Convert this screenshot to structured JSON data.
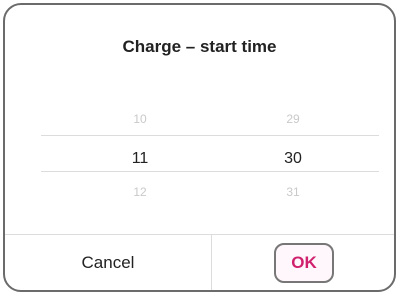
{
  "dialog": {
    "title": "Charge – start time"
  },
  "picker": {
    "hours": {
      "prev": "10",
      "selected": "11",
      "next": "12"
    },
    "minutes": {
      "prev": "29",
      "selected": "30",
      "next": "31"
    }
  },
  "buttons": {
    "cancel_label": "Cancel",
    "ok_label": "OK"
  },
  "colors": {
    "accent": "#d0216e",
    "faded_text": "#c9c9c9",
    "text": "#222222"
  }
}
